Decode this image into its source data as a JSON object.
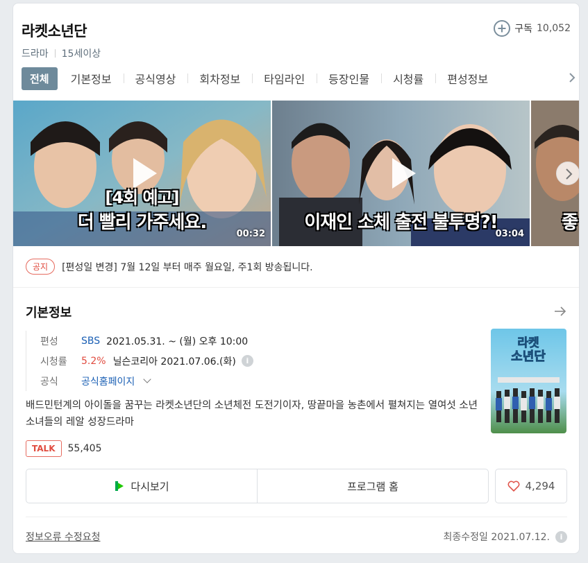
{
  "program": {
    "title": "라켓소년단",
    "subscribe_label": "구독",
    "subscribe_count": "10,052",
    "genre": "드라마",
    "rating": "15세이상"
  },
  "tabs": [
    {
      "label": "전체",
      "active": true
    },
    {
      "label": "기본정보"
    },
    {
      "label": "공식영상"
    },
    {
      "label": "회차정보"
    },
    {
      "label": "타임라인"
    },
    {
      "label": "등장인물"
    },
    {
      "label": "시청률"
    },
    {
      "label": "편성정보"
    }
  ],
  "videos": [
    {
      "caption_line1": "[4회 예고]",
      "caption_line2": "더 빨리 가주세요.",
      "duration": "00:32"
    },
    {
      "caption_line1": "",
      "caption_line2": "이재인 소체 출전 불투명?!",
      "duration": "03:04"
    },
    {
      "caption_line1": "",
      "caption_line2": "좋",
      "duration": ""
    }
  ],
  "notice": {
    "badge": "공지",
    "text": "[편성일 변경] 7월 12일 부터 매주 월요일, 주1회 방송됩니다."
  },
  "basic_info": {
    "section_title": "기본정보",
    "schedule_label": "편성",
    "channel": "SBS",
    "schedule": "2021.05.31. ~  (월) 오후 10:00",
    "ratings_label": "시청률",
    "ratings_value": "5.2%",
    "ratings_source": "닐슨코리아 2021.07.06.(화)",
    "official_label": "공식",
    "official_link": "공식홈페이지",
    "poster_title_line1": "라켓",
    "poster_title_line2": "소년단",
    "description": "배드민턴계의 아이돌을 꿈꾸는 라켓소년단의 소년체전 도전기이자, 땅끝마을 농촌에서 펼쳐지는 열여섯 소년소녀들의 레알 성장드라마"
  },
  "talk": {
    "badge": "TALK",
    "count": "55,405"
  },
  "actions": {
    "replay_label": "다시보기",
    "home_label": "프로그램 홈",
    "like_count": "4,294"
  },
  "footer": {
    "report_label": "정보오류 수정요청",
    "updated": "최종수정일 2021.07.12."
  },
  "colors": {
    "active_tab_bg": "#6e8a9b",
    "link": "#1a5fb4",
    "accent_red": "#e04b3f"
  }
}
